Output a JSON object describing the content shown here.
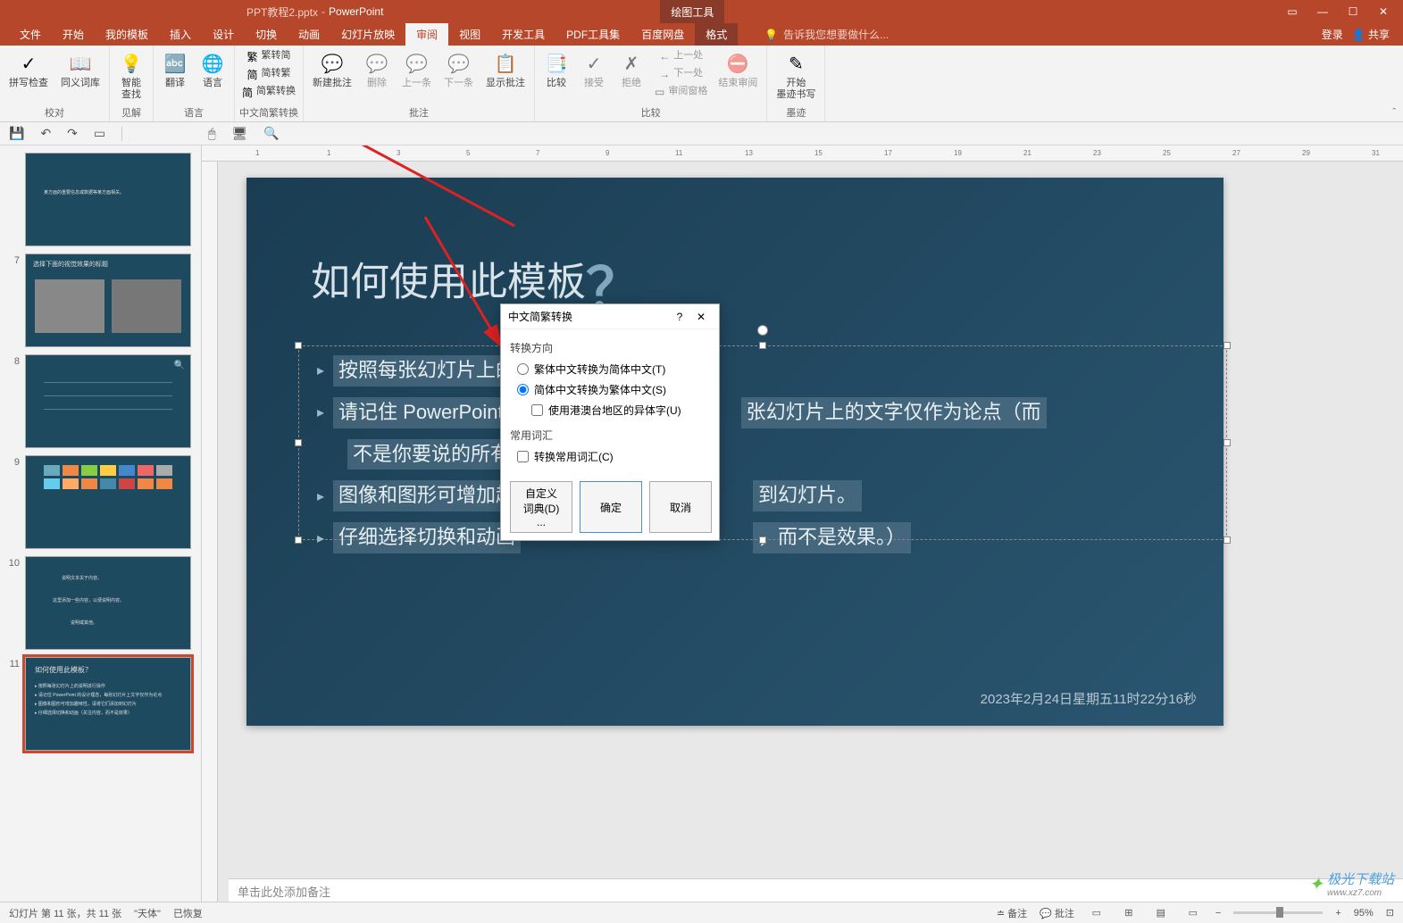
{
  "titlebar": {
    "doc_name": "PPT教程2.pptx",
    "app_name": "PowerPoint",
    "context_tool": "绘图工具"
  },
  "menubar": {
    "tabs": [
      "文件",
      "开始",
      "我的模板",
      "插入",
      "设计",
      "切换",
      "动画",
      "幻灯片放映",
      "审阅",
      "视图",
      "开发工具",
      "PDF工具集",
      "百度网盘",
      "格式"
    ],
    "active_index": 8,
    "tell_me": "告诉我您想要做什么...",
    "login": "登录",
    "share": "共享"
  },
  "ribbon": {
    "groups": [
      {
        "label": "校对",
        "items": [
          {
            "name": "spellcheck",
            "text": "拼写检查"
          },
          {
            "name": "thesaurus",
            "text": "同义词库"
          }
        ]
      },
      {
        "label": "见解",
        "items": [
          {
            "name": "smart-lookup",
            "text": "智能\n查找"
          }
        ]
      },
      {
        "label": "语言",
        "items": [
          {
            "name": "translate",
            "text": "翻译"
          },
          {
            "name": "language",
            "text": "语言"
          }
        ]
      },
      {
        "label": "中文简繁转换",
        "items": [
          {
            "name": "trad-to-simp",
            "text": "繁转简",
            "small": true
          },
          {
            "name": "simp-to-trad",
            "text": "简转繁",
            "small": true
          },
          {
            "name": "simp-trad-convert",
            "text": "简繁转换",
            "small": true
          }
        ]
      },
      {
        "label": "批注",
        "items": [
          {
            "name": "new-comment",
            "text": "新建批注"
          },
          {
            "name": "delete-comment",
            "text": "删除"
          },
          {
            "name": "prev-comment",
            "text": "上一条"
          },
          {
            "name": "next-comment",
            "text": "下一条"
          },
          {
            "name": "show-comments",
            "text": "显示批注"
          }
        ]
      },
      {
        "label": "比较",
        "items": [
          {
            "name": "compare",
            "text": "比较"
          },
          {
            "name": "accept",
            "text": "接受"
          },
          {
            "name": "reject",
            "text": "拒绝"
          },
          {
            "name": "prev-change",
            "text": "上一处",
            "small": true
          },
          {
            "name": "next-change",
            "text": "下一处",
            "small": true
          },
          {
            "name": "review-pane",
            "text": "审阅窗格",
            "small": true
          },
          {
            "name": "end-review",
            "text": "结束审阅"
          }
        ]
      },
      {
        "label": "墨迹",
        "items": [
          {
            "name": "start-ink",
            "text": "开始\n墨迹书写"
          }
        ]
      }
    ]
  },
  "thumbs": [
    {
      "n": "",
      "sel": false
    },
    {
      "n": "7",
      "sel": false,
      "title": "选择下面的视觉效果的标题"
    },
    {
      "n": "8",
      "sel": false
    },
    {
      "n": "9",
      "sel": false,
      "gallery": true
    },
    {
      "n": "10",
      "sel": false
    },
    {
      "n": "11",
      "sel": true,
      "title": "如何使用此模板？"
    }
  ],
  "slide": {
    "title": "如何使用此模板",
    "bullets_left": [
      "按照每张幻灯片上的",
      "请记住 PowerPoint",
      "不是你要说的所有内",
      "图像和图形可增加趣",
      "仔细选择切换和动画"
    ],
    "bullets_right": [
      "张幻灯片上的文字仅作为论点（而",
      "到幻灯片。",
      "，而不是效果。）"
    ],
    "timestamp": "2023年2月24日星期五11时22分16秒"
  },
  "dialog": {
    "title": "中文简繁转换",
    "section1": "转换方向",
    "opt1": "繁体中文转换为简体中文(T)",
    "opt2": "简体中文转换为繁体中文(S)",
    "chk1": "使用港澳台地区的异体字(U)",
    "section2": "常用词汇",
    "chk2": "转换常用词汇(C)",
    "btn_dict": "自定义词典(D) ...",
    "btn_ok": "确定",
    "btn_cancel": "取消"
  },
  "notes": "单击此处添加备注",
  "statusbar": {
    "slide_info": "幻灯片 第 11 张，共 11 张",
    "lang": "\"天体\"",
    "recover": "已恢复",
    "notes_btn": "备注",
    "comments_btn": "批注",
    "zoom": "95%"
  },
  "watermark": {
    "brand": "极光下载站",
    "url": "www.xz7.com"
  }
}
